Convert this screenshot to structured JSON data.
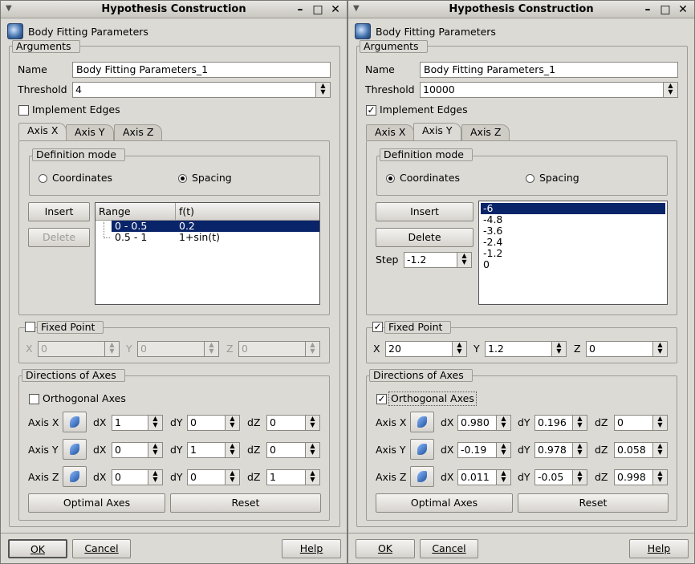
{
  "left": {
    "title": "Hypothesis Construction",
    "header": "Body Fitting Parameters",
    "arguments_label": "Arguments",
    "name_label": "Name",
    "name_value": "Body Fitting Parameters_1",
    "threshold_label": "Threshold",
    "threshold_value": "4",
    "implement_edges_label": "Implement Edges",
    "implement_edges_checked": false,
    "tabs": [
      "Axis X",
      "Axis Y",
      "Axis Z"
    ],
    "active_tab": "Axis X",
    "definition_mode_label": "Definition mode",
    "coordinates_label": "Coordinates",
    "spacing_label": "Spacing",
    "insert_label": "Insert",
    "delete_label": "Delete",
    "table_headers": [
      "Range",
      "f(t)"
    ],
    "table_rows": [
      {
        "range": "0 - 0.5",
        "ft": "0.2"
      },
      {
        "range": "0.5 - 1",
        "ft": "1+sin(t)"
      }
    ],
    "fixed_point_label": "Fixed Point",
    "fixed": {
      "x_label": "X",
      "x": "0",
      "y_label": "Y",
      "y": "0",
      "z_label": "Z",
      "z": "0"
    },
    "directions_label": "Directions of Axes",
    "orthogonal_label": "Orthogonal Axes",
    "axes": [
      {
        "label": "Axis X",
        "dx": "1",
        "dy": "0",
        "dz": "0"
      },
      {
        "label": "Axis Y",
        "dx": "0",
        "dy": "1",
        "dz": "0"
      },
      {
        "label": "Axis Z",
        "dx": "0",
        "dy": "0",
        "dz": "1"
      }
    ],
    "dx_label": "dX",
    "dy_label": "dY",
    "dz_label": "dZ",
    "optimal_label": "Optimal Axes",
    "reset_label": "Reset",
    "ok_label": "OK",
    "cancel_label": "Cancel",
    "help_label": "Help"
  },
  "right": {
    "title": "Hypothesis Construction",
    "header": "Body Fitting Parameters",
    "arguments_label": "Arguments",
    "name_label": "Name",
    "name_value": "Body Fitting Parameters_1",
    "threshold_label": "Threshold",
    "threshold_value": "10000",
    "implement_edges_label": "Implement Edges",
    "implement_edges_checked": true,
    "tabs": [
      "Axis X",
      "Axis Y",
      "Axis Z"
    ],
    "active_tab": "Axis Y",
    "definition_mode_label": "Definition mode",
    "coordinates_label": "Coordinates",
    "spacing_label": "Spacing",
    "insert_label": "Insert",
    "delete_label": "Delete",
    "step_label": "Step",
    "step_value": "-1.2",
    "coords_list": [
      "-6",
      "-4.8",
      "-3.6",
      "-2.4",
      "-1.2",
      "0"
    ],
    "fixed_point_label": "Fixed Point",
    "fixed": {
      "x_label": "X",
      "x": "20",
      "y_label": "Y",
      "y": "1.2",
      "z_label": "Z",
      "z": "0"
    },
    "directions_label": "Directions of Axes",
    "orthogonal_label": "Orthogonal Axes",
    "axes": [
      {
        "label": "Axis X",
        "dx": "0.980",
        "dy": "0.196",
        "dz": "0"
      },
      {
        "label": "Axis Y",
        "dx": "-0.19",
        "dy": "0.978",
        "dz": "0.058"
      },
      {
        "label": "Axis Z",
        "dx": "0.011",
        "dy": "-0.05",
        "dz": "0.998"
      }
    ],
    "dx_label": "dX",
    "dy_label": "dY",
    "dz_label": "dZ",
    "optimal_label": "Optimal Axes",
    "reset_label": "Reset",
    "ok_label": "OK",
    "cancel_label": "Cancel",
    "help_label": "Help"
  },
  "icons": {
    "menu": "pin-icon",
    "minimize": "minimize-icon",
    "maximize": "maximize-icon",
    "close": "close-icon",
    "hypothesis": "hypothesis-icon",
    "axis_tool": "axis-direction-icon"
  },
  "colors": {
    "selection": "#0a246a",
    "background": "#dcdad5"
  }
}
